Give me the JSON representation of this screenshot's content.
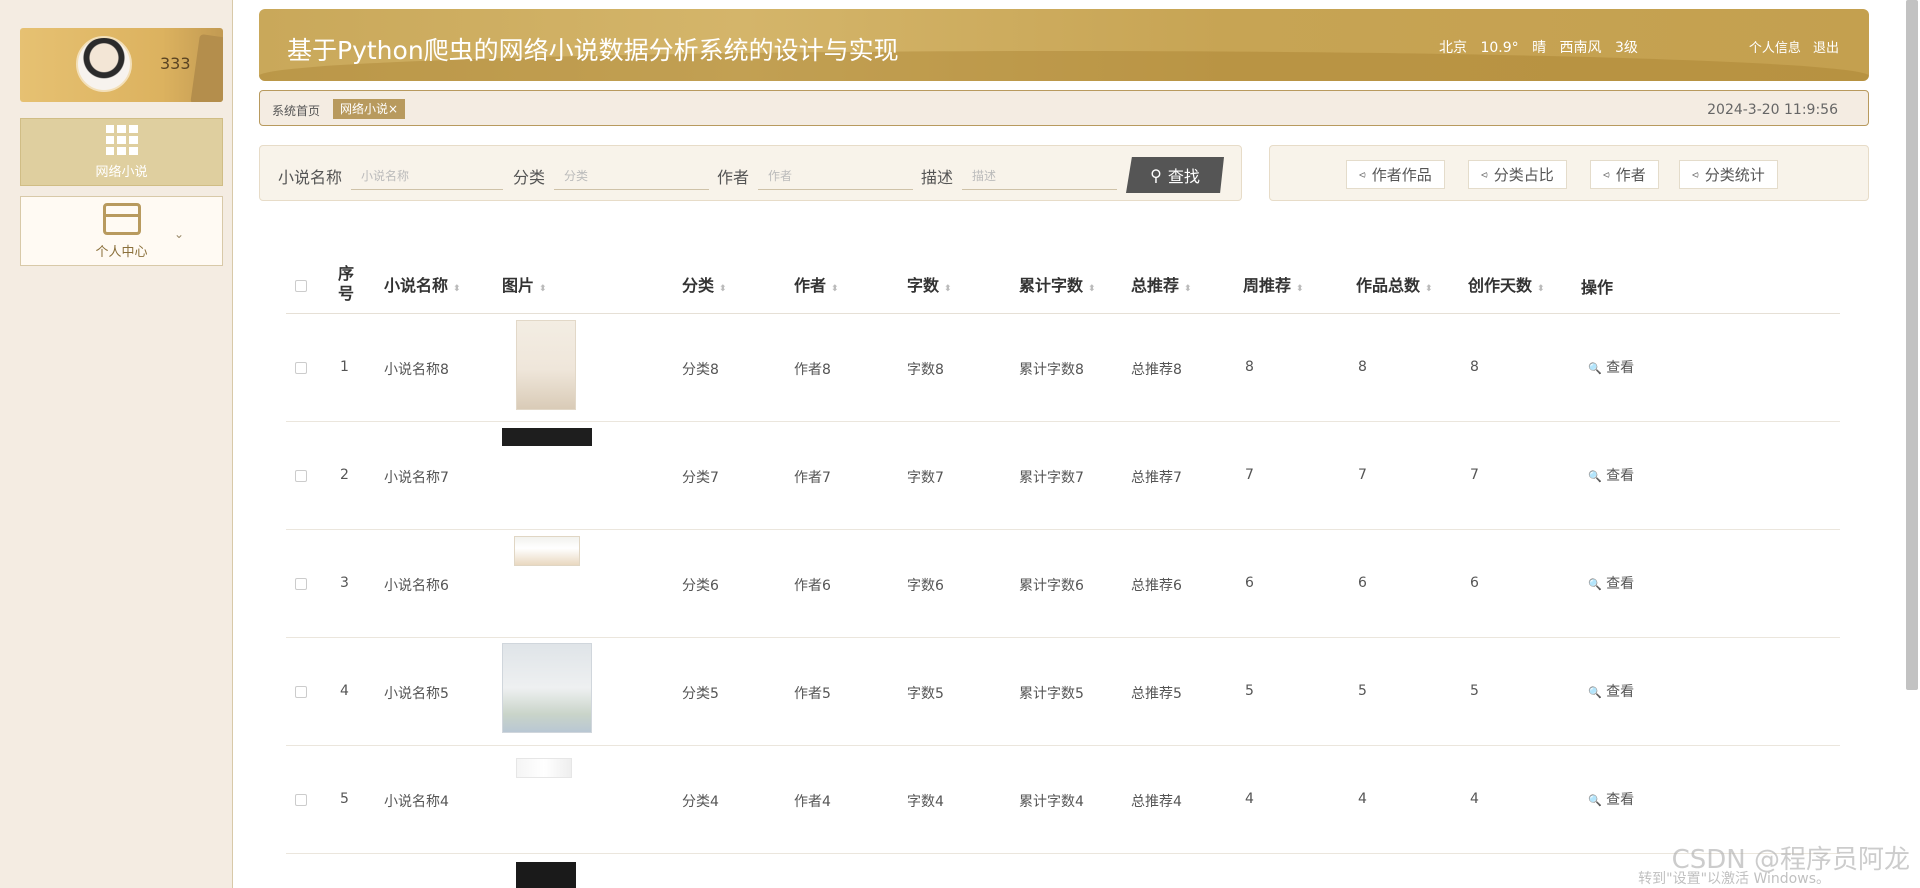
{
  "sidebar": {
    "username": "333",
    "items": [
      {
        "label": "网络小说"
      },
      {
        "label": "个人中心"
      }
    ]
  },
  "header": {
    "title": "基于Python爬虫的网络小说数据分析系统的设计与实现",
    "weather": {
      "city": "北京",
      "temp": "10.9°",
      "condition": "晴",
      "wind": "西南风",
      "level": "3级"
    },
    "links": {
      "profile": "个人信息",
      "logout": "退出"
    }
  },
  "breadcrumb": {
    "home": "系统首页",
    "active_tag": "网络小说×",
    "datetime": "2024-3-20 11:9:56"
  },
  "search": {
    "fields": [
      {
        "label": "小说名称",
        "placeholder": "小说名称"
      },
      {
        "label": "分类",
        "placeholder": "分类"
      },
      {
        "label": "作者",
        "placeholder": "作者"
      },
      {
        "label": "描述",
        "placeholder": "描述"
      }
    ],
    "button": "查找"
  },
  "actions": [
    "作者作品",
    "分类占比",
    "作者",
    "分类统计"
  ],
  "table": {
    "headers": {
      "index": "序号",
      "name": "小说名称",
      "image": "图片",
      "category": "分类",
      "author": "作者",
      "words": "字数",
      "total_words": "累计字数",
      "total_rec": "总推荐",
      "week_rec": "周推荐",
      "works": "作品总数",
      "days": "创作天数",
      "ops": "操作"
    },
    "rows": [
      {
        "index": "1",
        "name": "小说名称8",
        "category": "分类8",
        "author": "作者8",
        "words": "字数8",
        "total_words": "累计字数8",
        "total_rec": "总推荐8",
        "week_rec": "8",
        "works": "8",
        "days": "8",
        "op": "查看"
      },
      {
        "index": "2",
        "name": "小说名称7",
        "category": "分类7",
        "author": "作者7",
        "words": "字数7",
        "total_words": "累计字数7",
        "total_rec": "总推荐7",
        "week_rec": "7",
        "works": "7",
        "days": "7",
        "op": "查看"
      },
      {
        "index": "3",
        "name": "小说名称6",
        "category": "分类6",
        "author": "作者6",
        "words": "字数6",
        "total_words": "累计字数6",
        "total_rec": "总推荐6",
        "week_rec": "6",
        "works": "6",
        "days": "6",
        "op": "查看"
      },
      {
        "index": "4",
        "name": "小说名称5",
        "category": "分类5",
        "author": "作者5",
        "words": "字数5",
        "total_words": "累计字数5",
        "total_rec": "总推荐5",
        "week_rec": "5",
        "works": "5",
        "days": "5",
        "op": "查看"
      },
      {
        "index": "5",
        "name": "小说名称4",
        "category": "分类4",
        "author": "作者4",
        "words": "字数4",
        "total_words": "累计字数4",
        "total_rec": "总推荐4",
        "week_rec": "4",
        "works": "4",
        "days": "4",
        "op": "查看"
      }
    ]
  },
  "watermark": {
    "line1": "CSDN @程序员阿龙",
    "line2": "转到\"设置\"以激活 Windows。"
  }
}
